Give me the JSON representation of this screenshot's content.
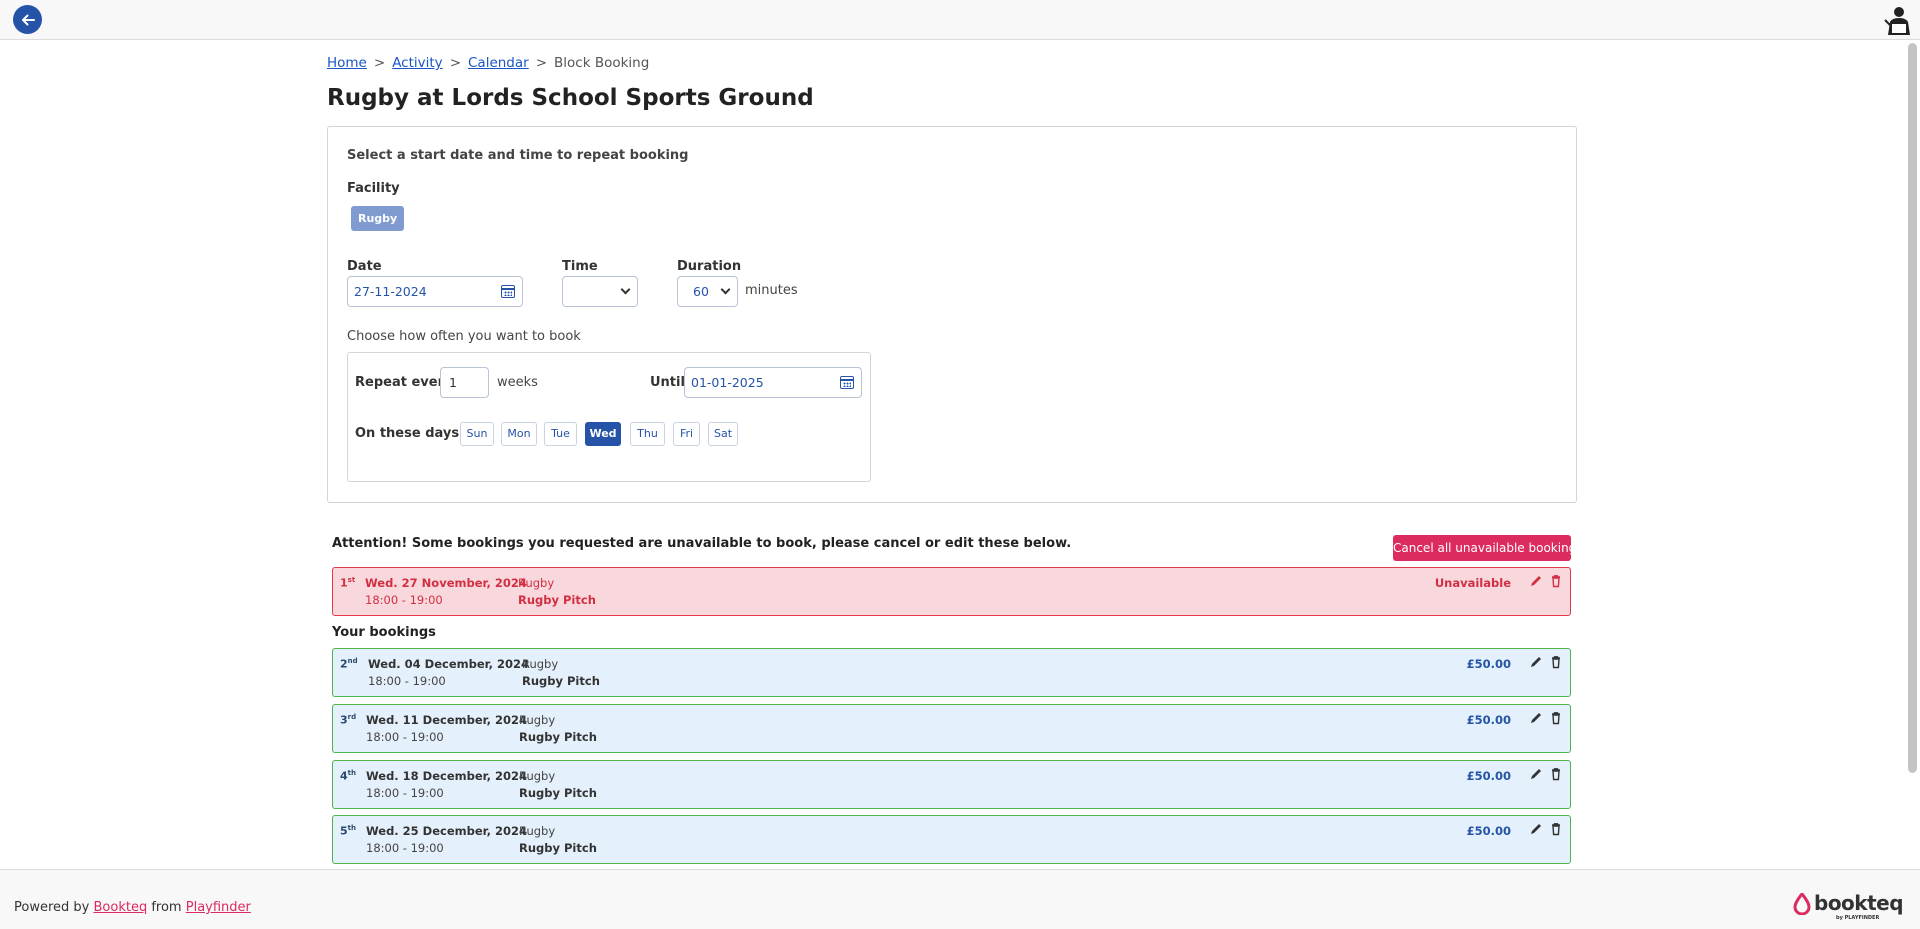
{
  "header": {
    "back_icon": "arrow-left-icon",
    "avatar_icon": "user-avatar-icon"
  },
  "breadcrumb": {
    "items": [
      "Home",
      "Activity",
      "Calendar"
    ],
    "current": "Block Booking",
    "separator": ">"
  },
  "page": {
    "title": "Rugby at Lords School Sports Ground"
  },
  "form": {
    "instruction": "Select a start date and time to repeat booking",
    "facility_label": "Facility",
    "facility_chip": "Rugby",
    "date_label": "Date",
    "date_value": "27-11-2024",
    "time_label": "Time",
    "time_value": "",
    "duration_label": "Duration",
    "duration_value": "60",
    "duration_unit": "minutes",
    "frequency_label": "Choose how often you want to book",
    "repeat_label": "Repeat every",
    "repeat_value": "1",
    "repeat_unit": "weeks",
    "until_label": "Until",
    "until_value": "01-01-2025",
    "days_label": "On these days:",
    "days": [
      "Sun",
      "Mon",
      "Tue",
      "Wed",
      "Thu",
      "Fri",
      "Sat"
    ],
    "selected_day": "Wed"
  },
  "attention": {
    "message": "Attention! Some bookings you requested are unavailable to book, please cancel or edit these below.",
    "cancel_all_label": "Cancel all unavailable bookings"
  },
  "unavailable_bookings": [
    {
      "num": "1",
      "suffix": "st",
      "date": "Wed. 27 November, 2024",
      "time": "18:00 - 19:00",
      "activity": "Rugby",
      "pitch": "Rugby Pitch",
      "status": "Unavailable"
    }
  ],
  "your_bookings_label": "Your bookings",
  "bookings": [
    {
      "num": "2",
      "suffix": "nd",
      "date": "Wed. 04 December, 2024",
      "time": "18:00 - 19:00",
      "activity": "Rugby",
      "pitch": "Rugby Pitch",
      "price": "£50.00"
    },
    {
      "num": "3",
      "suffix": "rd",
      "date": "Wed. 11 December, 2024",
      "time": "18:00 - 19:00",
      "activity": "Rugby",
      "pitch": "Rugby Pitch",
      "price": "£50.00"
    },
    {
      "num": "4",
      "suffix": "th",
      "date": "Wed. 18 December, 2024",
      "time": "18:00 - 19:00",
      "activity": "Rugby",
      "pitch": "Rugby Pitch",
      "price": "£50.00"
    },
    {
      "num": "5",
      "suffix": "th",
      "date": "Wed. 25 December, 2024",
      "time": "18:00 - 19:00",
      "activity": "Rugby",
      "pitch": "Rugby Pitch",
      "price": "£50.00"
    }
  ],
  "footer": {
    "powered_by": "Powered by",
    "link1": "Bookteq",
    "from": "from",
    "link2": "Playfinder",
    "brand_name": "bookteq",
    "brand_sub": "by PLAYFINDER"
  },
  "colors": {
    "primary": "#2553a8",
    "accent": "#dc2b5e",
    "unavailable_bg": "#f8d7dd",
    "unavailable_border": "#e03b4a",
    "booking_bg": "#e4f0fb",
    "booking_border": "#4cb64c"
  }
}
